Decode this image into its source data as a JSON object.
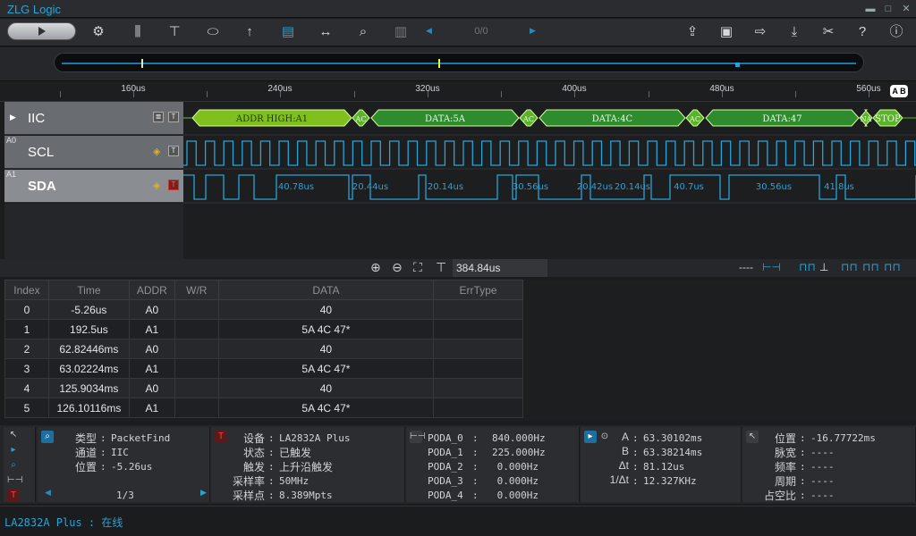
{
  "app": {
    "title": "ZLG Logic"
  },
  "window": {
    "minimize": "▬",
    "maximize": "□",
    "close": "✕"
  },
  "toolbar": {
    "page_count": "0/0"
  },
  "ruler": {
    "labels": [
      "160us",
      "240us",
      "320us",
      "400us",
      "480us",
      "560us"
    ],
    "ab_badge": "A B"
  },
  "channels": [
    {
      "index": "",
      "name": "IIC"
    },
    {
      "index": "A0",
      "name": "SCL"
    },
    {
      "index": "A1",
      "name": "SDA"
    }
  ],
  "iic_packets": [
    {
      "label": "ADDR HIGH:A1",
      "color": "#7fbf1e"
    },
    {
      "label": "AC",
      "color": "#5ab32a"
    },
    {
      "label": "DATA:5A",
      "color": "#2e8c2e"
    },
    {
      "label": "AC",
      "color": "#5ab32a"
    },
    {
      "label": "DATA:4C",
      "color": "#2e8c2e"
    },
    {
      "label": "AC",
      "color": "#5ab32a"
    },
    {
      "label": "DATA:47",
      "color": "#2e8c2e"
    },
    {
      "label": "NA",
      "color": "#5ab32a"
    },
    {
      "label": "STOP",
      "color": "#5ab32a"
    }
  ],
  "sda_measurements": [
    "40.78us",
    "20.44us",
    "20.14us",
    "30.56us",
    "20.42us",
    "20.14us",
    "40.7us",
    "30.56us",
    "41.8us"
  ],
  "zoombar": {
    "cursor_value": "384.84us"
  },
  "table": {
    "headers": [
      "Index",
      "Time",
      "ADDR",
      "W/R",
      "DATA",
      "ErrType"
    ],
    "rows": [
      [
        "0",
        "-5.26us",
        "A0",
        "",
        "40",
        ""
      ],
      [
        "1",
        "192.5us",
        "A1",
        "",
        "5A 4C 47*",
        ""
      ],
      [
        "2",
        "62.82446ms",
        "A0",
        "",
        "40",
        ""
      ],
      [
        "3",
        "63.02224ms",
        "A1",
        "",
        "5A 4C 47*",
        ""
      ],
      [
        "4",
        "125.9034ms",
        "A0",
        "",
        "40",
        ""
      ],
      [
        "5",
        "126.10116ms",
        "A1",
        "",
        "5A 4C 47*",
        ""
      ]
    ]
  },
  "search_panel": {
    "type_label": "类型",
    "type_value": "PacketFind",
    "channel_label": "通道",
    "channel_value": "IIC",
    "pos_label": "位置",
    "pos_value": "-5.26us",
    "page": "1/3"
  },
  "device_panel": {
    "device_label": "设备",
    "device_value": "LA2832A Plus",
    "state_label": "状态",
    "state_value": "已触发",
    "trigger_label": "触发",
    "trigger_value": "上升沿触发",
    "rate_label": "采样率",
    "rate_value": "50MHz",
    "points_label": "采样点",
    "points_value": "8.389Mpts"
  },
  "freq_panel": [
    {
      "name": "PODA_0",
      "value": "840.000Hz"
    },
    {
      "name": "PODA_1",
      "value": "225.000Hz"
    },
    {
      "name": "PODA_2",
      "value": "0.000Hz"
    },
    {
      "name": "PODA_3",
      "value": "0.000Hz"
    },
    {
      "name": "PODA_4",
      "value": "0.000Hz"
    }
  ],
  "cursor_panel": {
    "a_label": "A",
    "a_value": "63.30102ms",
    "b_label": "B",
    "b_value": "63.38214ms",
    "dt_label": "Δt",
    "dt_value": "81.12us",
    "inv_label": "1/Δt",
    "inv_value": "12.327KHz"
  },
  "measure_panel": {
    "pos_label": "位置",
    "pos_value": "-16.77722ms",
    "width_label": "脉宽",
    "width_value": "----",
    "freq_label": "频率",
    "freq_value": "----",
    "period_label": "周期",
    "period_value": "----",
    "duty_label": "占空比",
    "duty_value": "----"
  },
  "status": {
    "text": "LA2832A Plus : 在线"
  }
}
